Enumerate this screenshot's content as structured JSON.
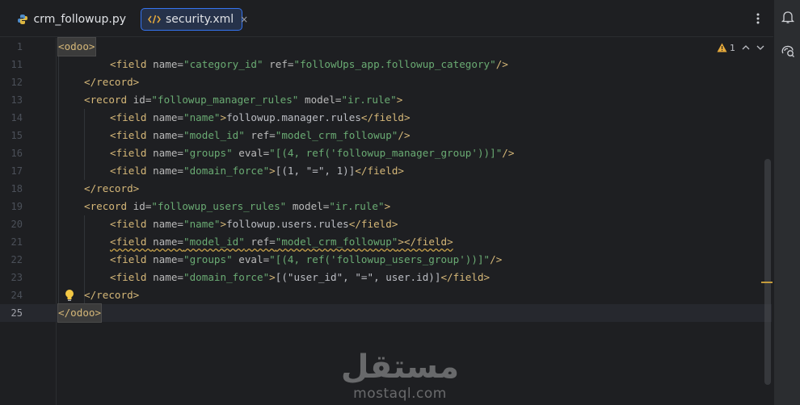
{
  "tabs": [
    {
      "label": "crm_followup.py",
      "icon": "python-file-icon",
      "active": false
    },
    {
      "label": "security.xml",
      "icon": "xml-file-icon",
      "active": true,
      "close": "×"
    }
  ],
  "inspection": {
    "warning_count": "1",
    "warning_color": "#e5a93b"
  },
  "colors": {
    "tag": "#d5b778",
    "attr": "#bababa",
    "value": "#6aab73",
    "text": "#bcbec4",
    "accent": "#3574f0"
  },
  "lines": [
    {
      "num": "1",
      "indent": 0,
      "tokens": [
        [
          "t",
          "<odoo>"
        ]
      ],
      "box": true
    },
    {
      "num": "11",
      "indent": 2,
      "tokens": [
        [
          "t",
          "<field "
        ],
        [
          "a",
          "name="
        ],
        [
          "v",
          "\"category_id\""
        ],
        [
          "a",
          " ref="
        ],
        [
          "v",
          "\"followUps_app.followup_category\""
        ],
        [
          "t",
          "/>"
        ]
      ]
    },
    {
      "num": "12",
      "indent": 1,
      "tokens": [
        [
          "t",
          "</record>"
        ]
      ]
    },
    {
      "num": "13",
      "indent": 1,
      "tokens": [
        [
          "t",
          "<record "
        ],
        [
          "a",
          "id="
        ],
        [
          "v",
          "\"followup_manager_rules\""
        ],
        [
          "a",
          " model="
        ],
        [
          "v",
          "\"ir.rule\""
        ],
        [
          "t",
          ">"
        ]
      ]
    },
    {
      "num": "14",
      "indent": 2,
      "tokens": [
        [
          "t",
          "<field "
        ],
        [
          "a",
          "name="
        ],
        [
          "v",
          "\"name\""
        ],
        [
          "t",
          ">"
        ],
        [
          "x",
          "followup.manager.rules"
        ],
        [
          "t",
          "</field>"
        ]
      ]
    },
    {
      "num": "15",
      "indent": 2,
      "tokens": [
        [
          "t",
          "<field "
        ],
        [
          "a",
          "name="
        ],
        [
          "v",
          "\"model_id\""
        ],
        [
          "a",
          " ref="
        ],
        [
          "v",
          "\"model_crm_followup\""
        ],
        [
          "t",
          "/>"
        ]
      ]
    },
    {
      "num": "16",
      "indent": 2,
      "tokens": [
        [
          "t",
          "<field "
        ],
        [
          "a",
          "name="
        ],
        [
          "v",
          "\"groups\""
        ],
        [
          "a",
          " eval="
        ],
        [
          "v",
          "\"[(4, ref('followup_manager_group'))]\""
        ],
        [
          "t",
          "/>"
        ]
      ]
    },
    {
      "num": "17",
      "indent": 2,
      "tokens": [
        [
          "t",
          "<field "
        ],
        [
          "a",
          "name="
        ],
        [
          "v",
          "\"domain_force\""
        ],
        [
          "t",
          ">"
        ],
        [
          "x",
          "[(1, \"=\", 1)]"
        ],
        [
          "t",
          "</field>"
        ]
      ]
    },
    {
      "num": "18",
      "indent": 1,
      "tokens": [
        [
          "t",
          "</record>"
        ]
      ]
    },
    {
      "num": "19",
      "indent": 1,
      "tokens": [
        [
          "t",
          "<record "
        ],
        [
          "a",
          "id="
        ],
        [
          "v",
          "\"followup_users_rules\""
        ],
        [
          "a",
          " model="
        ],
        [
          "v",
          "\"ir.rule\""
        ],
        [
          "t",
          ">"
        ]
      ]
    },
    {
      "num": "20",
      "indent": 2,
      "tokens": [
        [
          "t",
          "<field "
        ],
        [
          "a",
          "name="
        ],
        [
          "v",
          "\"name\""
        ],
        [
          "t",
          ">"
        ],
        [
          "x",
          "followup.users.rules"
        ],
        [
          "t",
          "</field>"
        ]
      ]
    },
    {
      "num": "21",
      "indent": 2,
      "warn": true,
      "tokens": [
        [
          "t",
          "<field "
        ],
        [
          "a",
          "name="
        ],
        [
          "v",
          "\"model_id\""
        ],
        [
          "a",
          " ref="
        ],
        [
          "v",
          "\"model_crm_followup\""
        ],
        [
          "t",
          "></field>"
        ]
      ]
    },
    {
      "num": "22",
      "indent": 2,
      "tokens": [
        [
          "t",
          "<field "
        ],
        [
          "a",
          "name="
        ],
        [
          "v",
          "\"groups\""
        ],
        [
          "a",
          " eval="
        ],
        [
          "v",
          "\"[(4, ref('followup_users_group'))]\""
        ],
        [
          "t",
          "/>"
        ]
      ]
    },
    {
      "num": "23",
      "indent": 2,
      "tokens": [
        [
          "t",
          "<field "
        ],
        [
          "a",
          "name="
        ],
        [
          "v",
          "\"domain_force\""
        ],
        [
          "t",
          ">"
        ],
        [
          "x",
          "[(\"user_id\", \"=\", user.id)]"
        ],
        [
          "t",
          "</field>"
        ]
      ]
    },
    {
      "num": "24",
      "indent": 1,
      "bulb": true,
      "tokens": [
        [
          "t",
          "</record>"
        ]
      ]
    },
    {
      "num": "25",
      "indent": 0,
      "current": true,
      "box": true,
      "tokens": [
        [
          "t",
          "</odoo>"
        ]
      ]
    }
  ],
  "watermark": {
    "arabic": "مستقل",
    "latin": "mostaql.com"
  }
}
